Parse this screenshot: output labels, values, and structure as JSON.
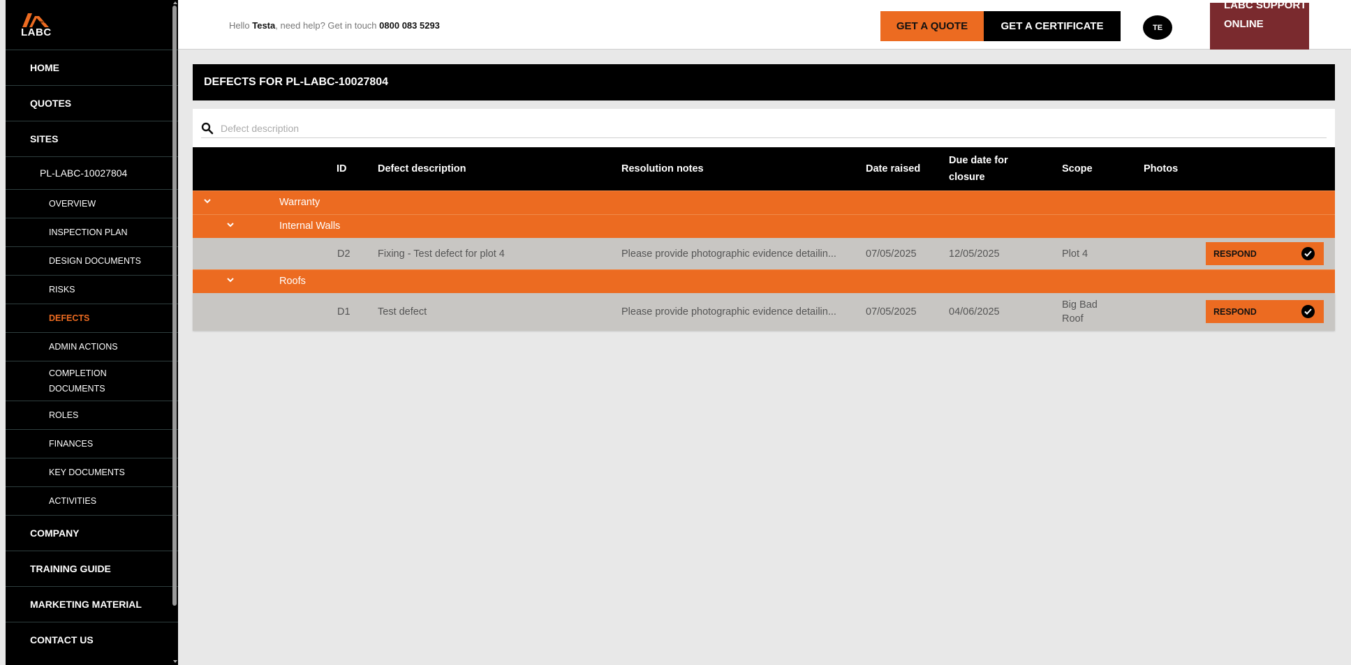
{
  "brand": {
    "logo_small": "warranty",
    "logo_text": "LABC",
    "accent": "#ec6b21",
    "support_color": "#7a2a2e"
  },
  "header": {
    "greeting_prefix": "Hello",
    "user_name": "Testa",
    "greeting_middle": ", need help? Get in touch",
    "phone": "0800 083 5293",
    "quote_button": "GET A QUOTE",
    "certificate_button": "GET A CERTIFICATE",
    "avatar_initials": "TE",
    "support_label": "LABC SUPPORT ONLINE"
  },
  "sidebar": {
    "top_items": [
      "HOME",
      "QUOTES",
      "SITES"
    ],
    "site_id": "PL-LABC-10027804",
    "sub_items": [
      "OVERVIEW",
      "INSPECTION PLAN",
      "DESIGN DOCUMENTS",
      "RISKS",
      "DEFECTS",
      "ADMIN ACTIONS",
      "COMPLETION\nDOCUMENTS",
      "ROLES",
      "FINANCES",
      "KEY DOCUMENTS",
      "ACTIVITIES"
    ],
    "active_sub_item": "DEFECTS",
    "bottom_items": [
      "COMPANY",
      "TRAINING GUIDE",
      "MARKETING MATERIAL",
      "CONTACT US"
    ]
  },
  "page": {
    "title": "DEFECTS FOR PL-LABC-10027804",
    "search_placeholder": "Defect description"
  },
  "table": {
    "columns": {
      "id": "ID",
      "description": "Defect description",
      "resolution": "Resolution notes",
      "date_raised": "Date raised",
      "due_date": "Due date for closure",
      "scope": "Scope",
      "photos": "Photos"
    },
    "group_level1": "Warranty",
    "groups": [
      {
        "label": "Internal Walls",
        "rows": [
          {
            "id": "D2",
            "description": "Fixing - Test defect for plot 4",
            "resolution": "Please provide photographic evidence detailin...",
            "date_raised": "07/05/2025",
            "due_date": "12/05/2025",
            "scope": "Plot 4",
            "action": "RESPOND"
          }
        ]
      },
      {
        "label": "Roofs",
        "rows": [
          {
            "id": "D1",
            "description": "Test defect",
            "resolution": "Please provide photographic evidence detailin...",
            "date_raised": "07/05/2025",
            "due_date": "04/06/2025",
            "scope": "Big Bad Roof",
            "action": "RESPOND"
          }
        ]
      }
    ]
  }
}
